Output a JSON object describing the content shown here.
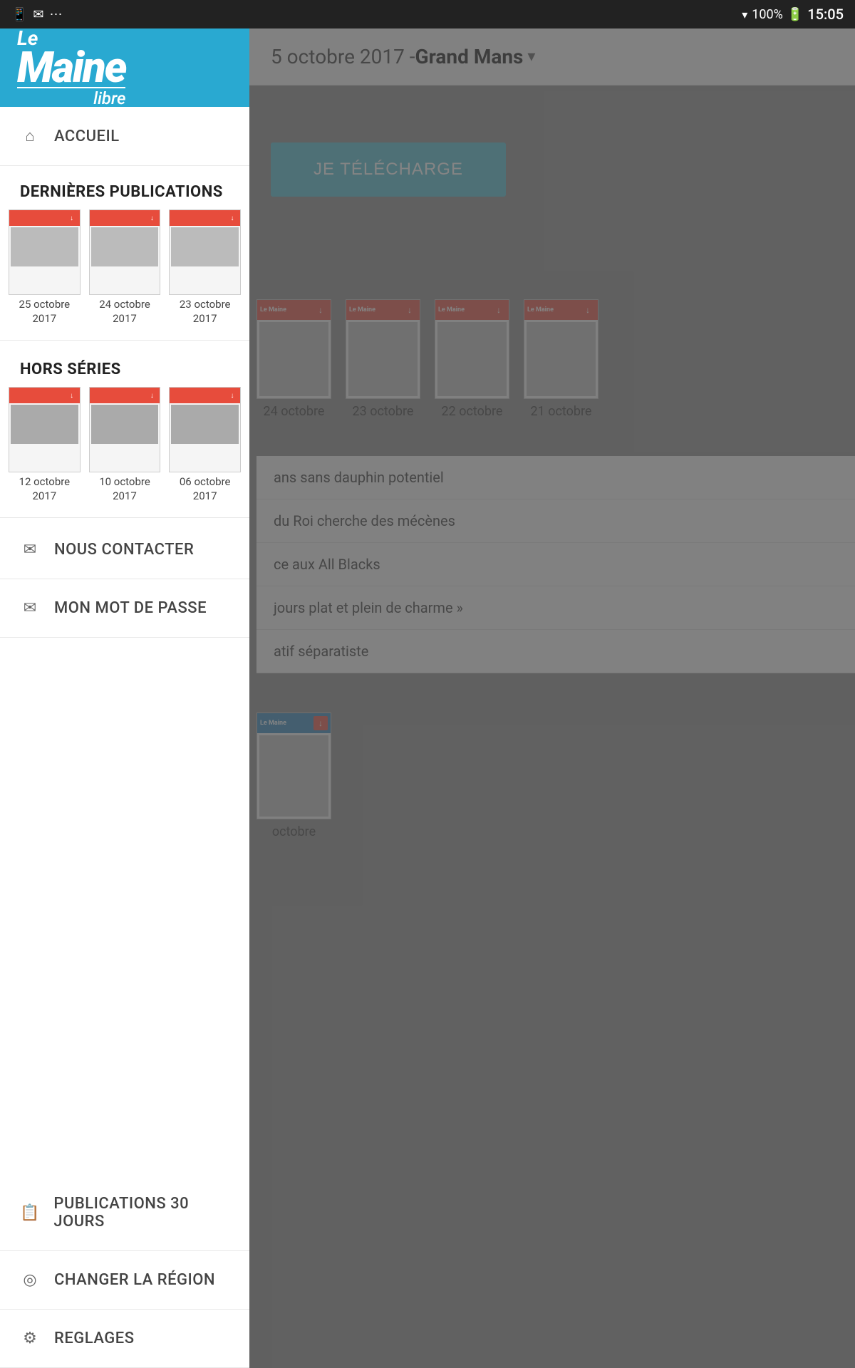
{
  "statusBar": {
    "time": "15:05",
    "battery": "100%",
    "batteryIcon": "🔋",
    "wifiIcon": "▾",
    "icons": [
      "✉",
      "📱",
      "⋯"
    ]
  },
  "mainHeader": {
    "date": "5 octobre 2017 - ",
    "region": "Grand Mans",
    "chevron": "▾"
  },
  "downloadButton": {
    "label": "JE TÉLÉCHARGE"
  },
  "sidebar": {
    "logo": {
      "le": "Le",
      "maine": "Maine",
      "libre": "libre"
    },
    "navItems": [
      {
        "id": "accueil",
        "label": "ACCUEIL",
        "icon": "⌂"
      },
      {
        "id": "nous-contacter",
        "label": "NOUS CONTACTER",
        "icon": "✉"
      },
      {
        "id": "mon-mot-de-passe",
        "label": "MON MOT DE PASSE",
        "icon": "✉"
      },
      {
        "id": "publications-30-jours",
        "label": "PUBLICATIONS 30 JOURS",
        "icon": "📋"
      },
      {
        "id": "changer-la-region",
        "label": "CHANGER LA RÉGION",
        "icon": "📍"
      },
      {
        "id": "reglages",
        "label": "REGLAGES",
        "icon": "⚙"
      }
    ],
    "sections": {
      "dernieresPublications": {
        "label": "DERNIÈRES PUBLICATIONS",
        "items": [
          {
            "date": "25 octobre\n2017",
            "color": "#c0392b"
          },
          {
            "date": "24 octobre\n2017",
            "color": "#c0392b"
          },
          {
            "date": "23 octobre\n2017",
            "color": "#c0392b"
          }
        ]
      },
      "horsSeries": {
        "label": "HORS SÉRIES",
        "items": [
          {
            "date": "12 octobre\n2017",
            "color": "#2980b9"
          },
          {
            "date": "10 octobre\n2017",
            "color": "#2980b9"
          },
          {
            "date": "06 octobre\n2017",
            "color": "#2980b9"
          }
        ]
      }
    }
  },
  "mainContent": {
    "newsThumbs1": [
      {
        "date": "24 octobre"
      },
      {
        "date": "23 octobre"
      },
      {
        "date": "22 octobre"
      },
      {
        "date": "21 octobre"
      }
    ],
    "newsItems": [
      {
        "text": "ans sans dauphin potentiel"
      },
      {
        "text": "du Roi cherche des mécènes"
      },
      {
        "text": "ce aux All Blacks"
      },
      {
        "text": "jours plat et plein de charme »"
      },
      {
        "text": "atif séparatiste"
      }
    ],
    "bottomThumb": {
      "date": "octobre"
    }
  }
}
